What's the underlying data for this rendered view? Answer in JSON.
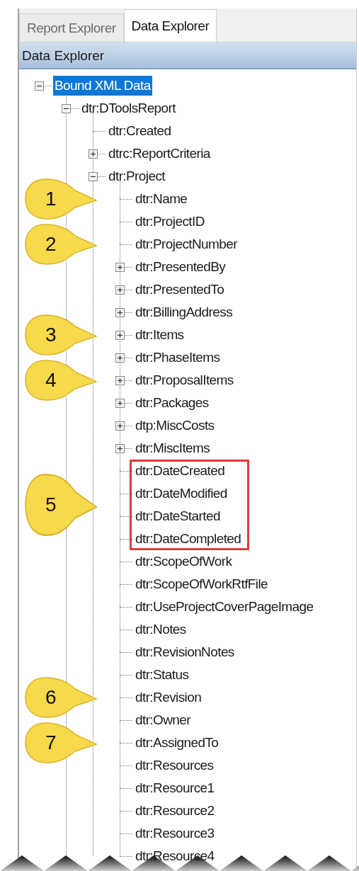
{
  "tabs": [
    {
      "label": "Report Explorer",
      "selected": false
    },
    {
      "label": "Data Explorer",
      "selected": true
    }
  ],
  "panel": {
    "title": "Data Explorer"
  },
  "tree": [
    {
      "label": "Bound XML Data",
      "selected": true,
      "expanded": true,
      "children": [
        {
          "label": "dtr:DToolsReport",
          "selected": false,
          "expanded": true,
          "children": [
            {
              "label": "dtr:Created",
              "selected": false
            },
            {
              "label": "dtrc:ReportCriteria",
              "selected": false,
              "expanded": false
            },
            {
              "label": "dtr:Project",
              "selected": false,
              "expanded": true,
              "children": [
                {
                  "label": "dtr:Name",
                  "selected": false,
                  "highlighted": false,
                  "callout": "1"
                },
                {
                  "label": "dtr:ProjectID",
                  "selected": false,
                  "highlighted": false
                },
                {
                  "label": "dtr:ProjectNumber",
                  "selected": false,
                  "highlighted": false,
                  "callout": "2"
                },
                {
                  "label": "dtr:PresentedBy",
                  "selected": false,
                  "highlighted": false,
                  "expanded": false
                },
                {
                  "label": "dtr:PresentedTo",
                  "selected": false,
                  "highlighted": false,
                  "expanded": false
                },
                {
                  "label": "dtr:BillingAddress",
                  "selected": false,
                  "highlighted": false,
                  "expanded": false
                },
                {
                  "label": "dtr:Items",
                  "selected": false,
                  "highlighted": false,
                  "expanded": false,
                  "callout": "3"
                },
                {
                  "label": "dtr:PhaseItems",
                  "selected": false,
                  "highlighted": false,
                  "expanded": false
                },
                {
                  "label": "dtr:ProposalItems",
                  "selected": false,
                  "highlighted": false,
                  "expanded": false,
                  "callout": "4"
                },
                {
                  "label": "dtr:Packages",
                  "selected": false,
                  "highlighted": false,
                  "expanded": false
                },
                {
                  "label": "dtp:MiscCosts",
                  "selected": false,
                  "highlighted": false,
                  "expanded": false
                },
                {
                  "label": "dtr:MiscItems",
                  "selected": false,
                  "highlighted": false,
                  "expanded": false
                },
                {
                  "label": "dtr:DateCreated",
                  "selected": false,
                  "highlighted": true
                },
                {
                  "label": "dtr:DateModified",
                  "selected": false,
                  "highlighted": true,
                  "callout": "5"
                },
                {
                  "label": "dtr:DateStarted",
                  "selected": false,
                  "highlighted": true
                },
                {
                  "label": "dtr:DateCompleted",
                  "selected": false,
                  "highlighted": true
                },
                {
                  "label": "dtr:ScopeOfWork",
                  "selected": false,
                  "highlighted": false
                },
                {
                  "label": "dtr:ScopeOfWorkRtfFile",
                  "selected": false,
                  "highlighted": false
                },
                {
                  "label": "dtr:UseProjectCoverPageImage",
                  "selected": false,
                  "highlighted": false
                },
                {
                  "label": "dtr:Notes",
                  "selected": false,
                  "highlighted": false
                },
                {
                  "label": "dtr:RevisionNotes",
                  "selected": false,
                  "highlighted": false
                },
                {
                  "label": "dtr:Status",
                  "selected": false,
                  "highlighted": false
                },
                {
                  "label": "dtr:Revision",
                  "selected": false,
                  "highlighted": false,
                  "callout": "6"
                },
                {
                  "label": "dtr:Owner",
                  "selected": false,
                  "highlighted": false
                },
                {
                  "label": "dtr:AssignedTo",
                  "selected": false,
                  "highlighted": false,
                  "callout": "7"
                },
                {
                  "label": "dtr:Resources",
                  "selected": false,
                  "highlighted": false
                },
                {
                  "label": "dtr:Resource1",
                  "selected": false,
                  "highlighted": false
                },
                {
                  "label": "dtr:Resource2",
                  "selected": false,
                  "highlighted": false
                },
                {
                  "label": "dtr:Resource3",
                  "selected": false,
                  "highlighted": false
                },
                {
                  "label": "dtr:Resource4",
                  "selected": false,
                  "highlighted": false
                }
              ]
            }
          ]
        }
      ]
    }
  ]
}
